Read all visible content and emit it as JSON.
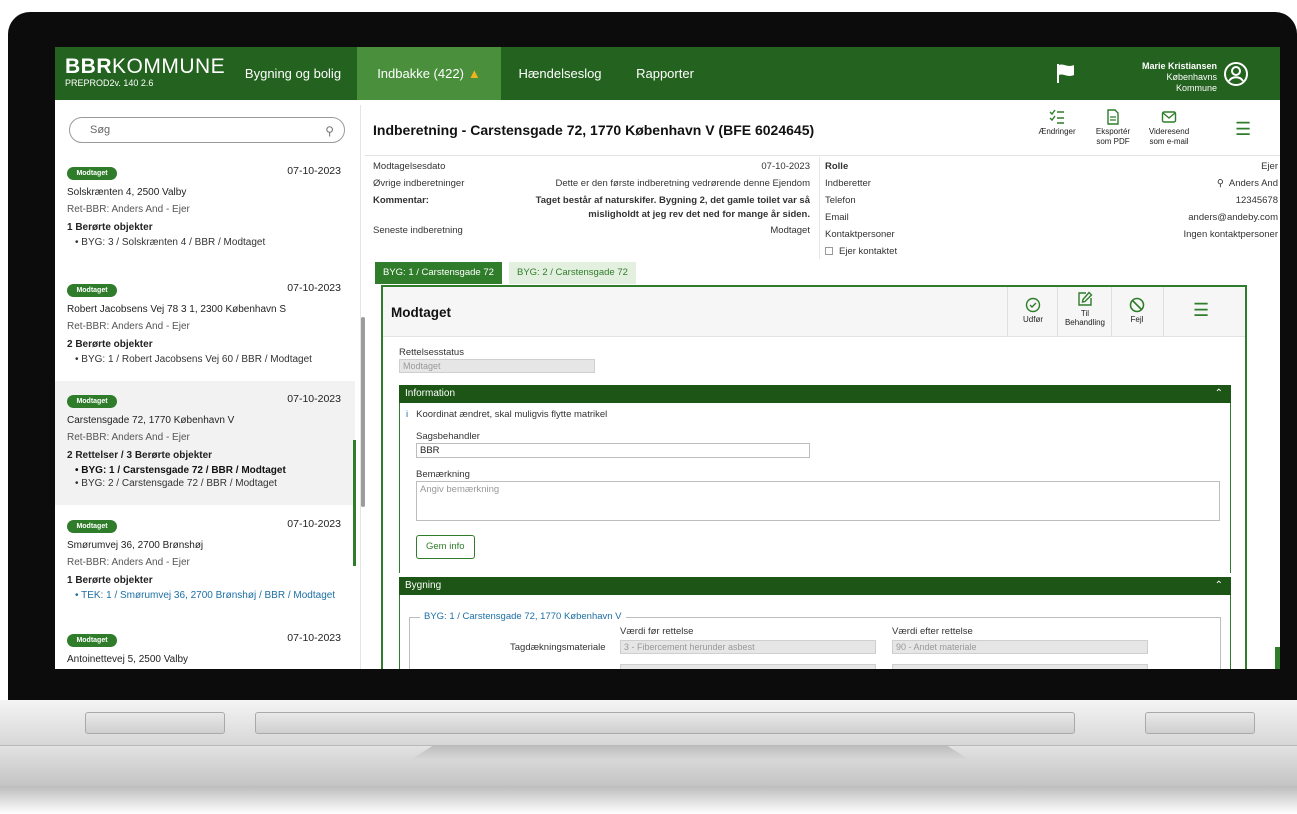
{
  "nav": {
    "brand_bold": "BBR",
    "brand_rest": "KOMMUNE",
    "brand_sub": "PREPROD2v. 140 2.6",
    "tabs": [
      {
        "label": "Bygning og bolig"
      },
      {
        "label": "Indbakke (422)"
      },
      {
        "label": "Hændelseslog"
      },
      {
        "label": "Rapporter"
      }
    ],
    "user_name": "Marie Kristiansen",
    "user_org": "Københavns Kommune"
  },
  "search": {
    "placeholder": "Søg"
  },
  "inbox": [
    {
      "badge": "Modtaget",
      "date": "07-10-2023",
      "address": "Solskrænten 4, 2500 Valby",
      "ret": "Ret-BBR: Anders And - Ejer",
      "count": "1 Berørte objekter",
      "lines": [
        "BYG: 3 / Solskrænten 4 / BBR / Modtaget"
      ]
    },
    {
      "badge": "Modtaget",
      "date": "07-10-2023",
      "address": "Robert Jacobsens Vej 78 3 1, 2300 København S",
      "ret": "Ret-BBR: Anders And - Ejer",
      "count": "2 Berørte objekter",
      "lines": [
        "BYG: 1 / Robert Jacobsens Vej 60 / BBR / Modtaget"
      ]
    },
    {
      "badge": "Modtaget",
      "date": "07-10-2023",
      "address": "Carstensgade 72, 1770 København V",
      "ret": "Ret-BBR: Anders And - Ejer",
      "count": "2 Rettelser / 3 Berørte objekter",
      "lines": [
        "BYG: 1 / Carstensgade 72 / BBR / Modtaget",
        "BYG: 2 / Carstensgade 72 / BBR / Modtaget"
      ]
    },
    {
      "badge": "Modtaget",
      "date": "07-10-2023",
      "address": "Smørumvej 36, 2700 Brønshøj",
      "ret": "Ret-BBR: Anders And - Ejer",
      "count": "1 Berørte objekter",
      "lines": [
        "TEK: 1 / Smørumvej 36, 2700 Brønshøj / BBR / Modtaget"
      ]
    },
    {
      "badge": "Modtaget",
      "date": "07-10-2023",
      "address": "Antoinettevej 5, 2500 Valby"
    }
  ],
  "main": {
    "title": "Indberetning - Carstensgade 72, 1770 København V (BFE 6024645)",
    "tools": [
      {
        "label1": "Ændringer",
        "label2": ""
      },
      {
        "label1": "Eksportér",
        "label2": "som PDF"
      },
      {
        "label1": "Videresend",
        "label2": "som e-mail"
      }
    ],
    "info_left": [
      {
        "label": "Modtagelsesdato",
        "value": "07-10-2023"
      },
      {
        "label": "Øvrige indberetninger",
        "value": "Dette er den første indberetning vedrørende denne Ejendom"
      },
      {
        "label": "Kommentar:",
        "value1": "Taget består af naturskifer. Bygning 2, det gamle toilet var så",
        "value2": "misligholdt at jeg rev det ned for mange år siden."
      },
      {
        "label": "Seneste indberetning",
        "value": "Modtaget"
      }
    ],
    "info_right": [
      {
        "label": "Rolle",
        "value": "Ejer"
      },
      {
        "label": "Indberetter",
        "value": "Anders And"
      },
      {
        "label": "Telefon",
        "value": "12345678"
      },
      {
        "label": "Email",
        "value": "anders@andeby.com"
      },
      {
        "label": "Kontaktpersoner",
        "value": "Ingen kontaktpersoner"
      },
      {
        "label": "Ejer kontaktet",
        "value": ""
      }
    ],
    "subtabs": [
      {
        "label": "BYG: 1 / Carstensgade 72"
      },
      {
        "label": "BYG: 2 / Carstensgade 72"
      }
    ],
    "panel": {
      "title": "Modtaget",
      "tools": [
        {
          "label1": "Udfør",
          "label2": ""
        },
        {
          "label1": "Til",
          "label2": "Behandling"
        },
        {
          "label1": "Fejl",
          "label2": ""
        }
      ],
      "status_label": "Rettelsesstatus",
      "status_value": "Modtaget",
      "info_section": "Information",
      "info_note": "Koordinat ændret, skal muligvis flytte matrikel",
      "sagsbehandler_label": "Sagsbehandler",
      "sagsbehandler_value": "BBR",
      "bemaerkning_label": "Bemærkning",
      "bemaerkning_placeholder": "Angiv bemærkning",
      "save_label": "Gem info",
      "bygning_section": "Bygning",
      "legend": "BYG: 1 / Carstensgade 72, 1770 København V",
      "col_before": "Værdi før rettelse",
      "col_after": "Værdi efter rettelse",
      "field_label": "Tagdækningsmateriale",
      "before_value": "3 - Fibercement herunder asbest",
      "after_value": "90 - Andet materiale"
    }
  },
  "colors": {
    "brand_green": "#24621f",
    "accent_green": "#2f7d2a",
    "section_green": "#1c5516",
    "warning": "#f2b21b"
  }
}
